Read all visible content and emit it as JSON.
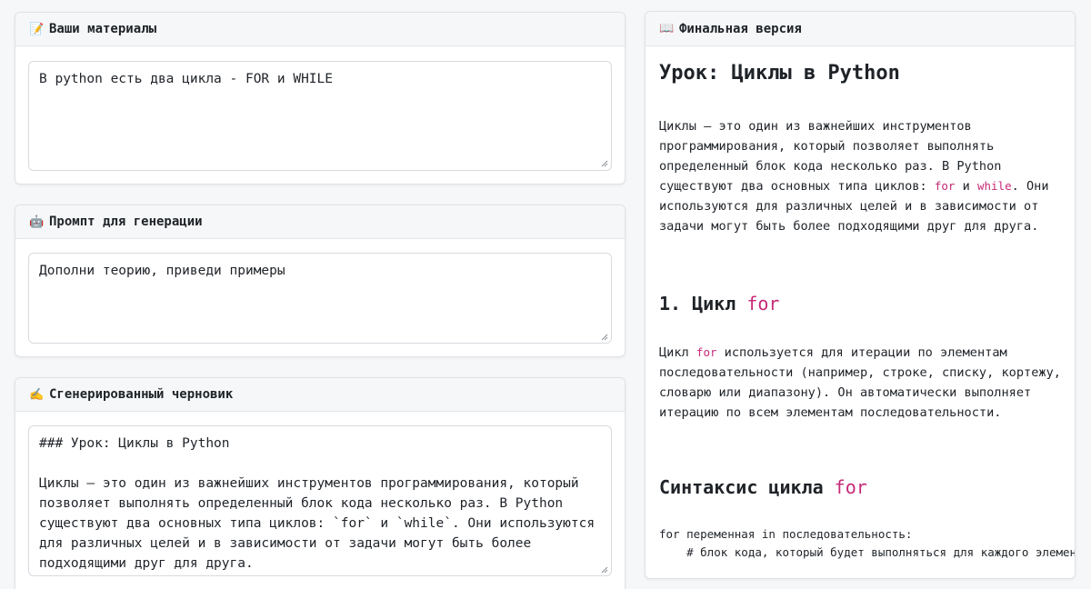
{
  "materials": {
    "emoji": "📝",
    "title": "Ваши материалы",
    "value": "В python есть два цикла - FOR и WHILE"
  },
  "prompt": {
    "emoji": "🤖",
    "title": "Промпт для генерации",
    "value": "Дополни теорию, приведи примеры"
  },
  "draft": {
    "emoji": "✍️",
    "title": "Сгенерированный черновик",
    "value": "### Урок: Циклы в Python\n\nЦиклы — это один из важнейших инструментов программирования, который позволяет выполнять определенный блок кода несколько раз. В Python существуют два основных типа циклов: `for` и `while`. Они используются для различных целей и в зависимости от задачи могут быть более подходящими друг для друга."
  },
  "final": {
    "emoji": "📖",
    "title": "Финальная версия",
    "h1": "Урок: Циклы в Python",
    "intro_a": "Циклы — это один из важнейших инструментов программирования, который позволяет выполнять определенный блок кода несколько раз. В Python существуют два основных типа циклов: ",
    "kw_for": "for",
    "and": " и ",
    "kw_while": "while",
    "intro_b": ". Они используются для различных целей и в зависимости от задачи могут быть более подходящими друг для друга.",
    "section1_title": "1. Цикл ",
    "section1_kw": "for",
    "section1_para_a": "Цикл ",
    "section1_para_kw": "for",
    "section1_para_b": " используется для итерации по элементам последовательности (например, строке, списку, кортежу, словарю или диапазону). Он автоматически выполняет итерацию по всем элементам последовательности.",
    "syntax_title": "Синтаксис цикла ",
    "syntax_kw": "for",
    "code": "for переменная in последовательность:\n    # блок кода, который будет выполняться для каждого элемен"
  },
  "colors": {
    "keyword": "#c62a77",
    "card_border": "#dfe2e6",
    "header_bg": "#f6f7f8"
  }
}
